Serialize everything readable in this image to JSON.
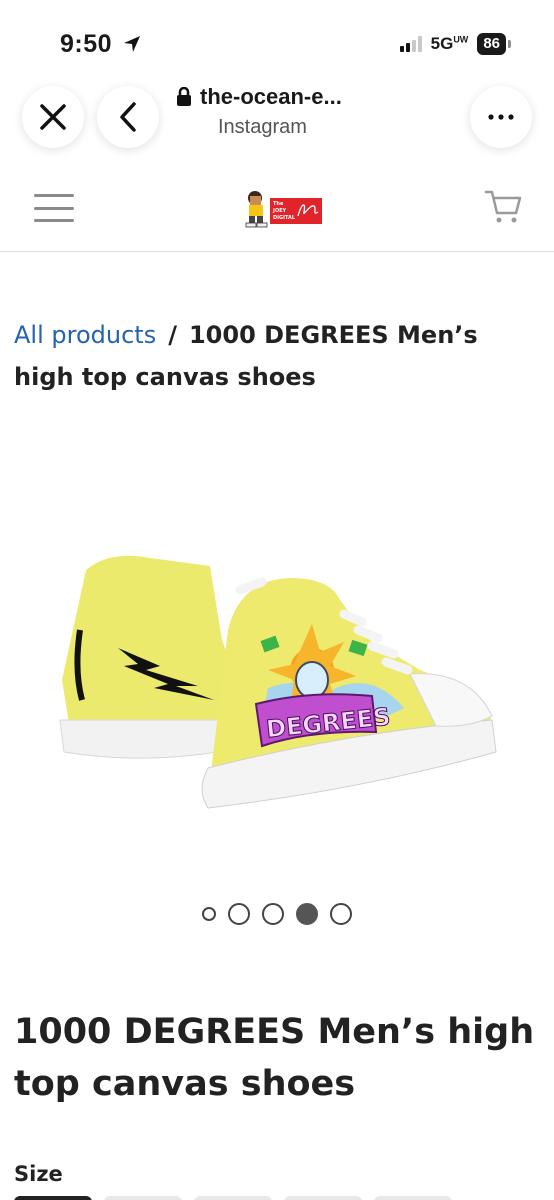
{
  "status_bar": {
    "time": "9:50",
    "network": "5G",
    "network_sup": "UW",
    "battery": "86"
  },
  "browser": {
    "url": "the-ocean-e...",
    "source": "Instagram"
  },
  "site": {
    "logo_text": "The JOEY DIGITAL"
  },
  "breadcrumb": {
    "link": "All products",
    "separator": "/",
    "current": "1000 DEGREES Men’s high top canvas shoes"
  },
  "product": {
    "title": "1000 DEGREES Men’s high top canvas shoes",
    "image_text": "DEGREES",
    "size_label": "Size"
  },
  "gallery": {
    "count": 5,
    "active_index": 3
  },
  "colors": {
    "shoe": "#eeea6e",
    "link": "#2563b0",
    "graffiti": "#c04fd0"
  }
}
